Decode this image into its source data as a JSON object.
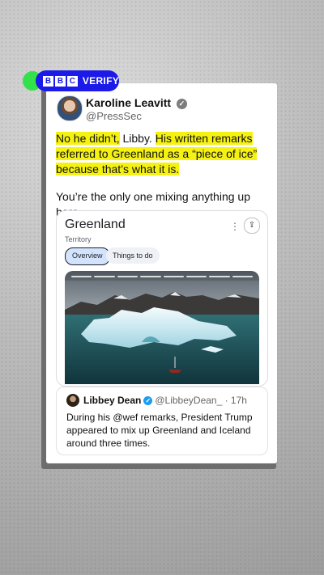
{
  "badge": {
    "bbc": [
      "B",
      "B",
      "C"
    ],
    "label": "VERIFY",
    "colors": {
      "badge": "#1b1ae8",
      "dot": "#33e24a"
    }
  },
  "tweet": {
    "author_name": "Karoline Leavitt",
    "author_handle": "@PressSec",
    "text_parts": {
      "p1_hl": "No he didn’t,",
      "p1_plain": " Libby. ",
      "p2_hl": "His written remarks referred to Greenland as a “piece of ice” because that’s what it is."
    },
    "text2": "You’re the only one mixing anything up here.",
    "highlight_color": "#f5f212"
  },
  "search_card": {
    "title": "Greenland",
    "subtitle": "Territory",
    "more_icon": "⋮",
    "share_icon": "share-icon",
    "chips": [
      "Overview",
      "Things to do"
    ]
  },
  "quoted_tweet": {
    "author_name": "Libbey Dean",
    "handle_time": "@LibbeyDean_ · 17h",
    "text": "During his @wef remarks, President Trump appeared to mix up Greenland and Iceland around three times."
  }
}
